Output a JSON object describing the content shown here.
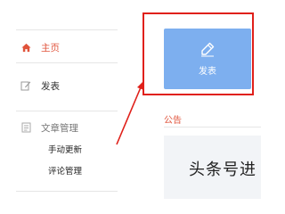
{
  "sidebar": {
    "home": {
      "label": "主页",
      "icon": "home-icon"
    },
    "post": {
      "label": "发表",
      "icon": "edit-doc-icon"
    },
    "article_section": {
      "title": "文章管理",
      "icon": "document-icon",
      "items": [
        {
          "label": "手动更新"
        },
        {
          "label": "评论管理"
        }
      ]
    }
  },
  "main": {
    "publish_card": {
      "label": "发表",
      "icon": "pen-icon"
    },
    "notice_label": "公告",
    "banner_text": "头条号进"
  },
  "colors": {
    "accent": "#e0533b",
    "card": "#7dafef",
    "annotation": "#e0201a"
  }
}
